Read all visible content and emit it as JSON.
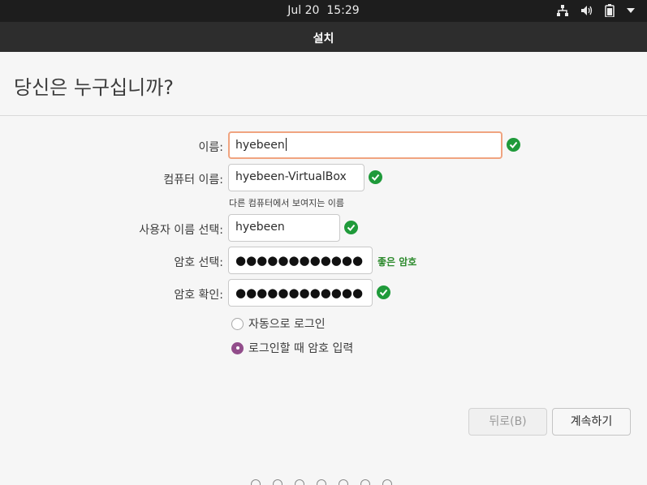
{
  "topbar": {
    "clock": "Jul 20  15:29",
    "icons": [
      "network-icon",
      "volume-icon",
      "battery-icon",
      "dropdown-arrow-icon"
    ]
  },
  "window": {
    "title": "설치"
  },
  "page": {
    "heading": "당신은 누구십니까?"
  },
  "form": {
    "name": {
      "label": "이름:",
      "value": "hyebeen"
    },
    "computer_name": {
      "label": "컴퓨터 이름:",
      "value": "hyebeen-VirtualBox",
      "hint": "다른 컴퓨터에서 보여지는 이름"
    },
    "username": {
      "label": "사용자 이름 선택:",
      "value": "hyebeen"
    },
    "password": {
      "label": "암호 선택:",
      "value": "●●●●●●●●●●●●",
      "strength": "좋은 암호"
    },
    "confirm": {
      "label": "암호 확인:",
      "value": "●●●●●●●●●●●●"
    }
  },
  "login_options": [
    {
      "label": "자동으로 로그인",
      "checked": false
    },
    {
      "label": "로그인할 때 암호 입력",
      "checked": true
    }
  ],
  "buttons": {
    "back": "뒤로(B)",
    "next": "계속하기"
  },
  "colors": {
    "accent_focus": "#f0a480",
    "check_green": "#1f9a3a",
    "radio_selected": "#924d8b",
    "strength_text": "#2c8a2c"
  }
}
